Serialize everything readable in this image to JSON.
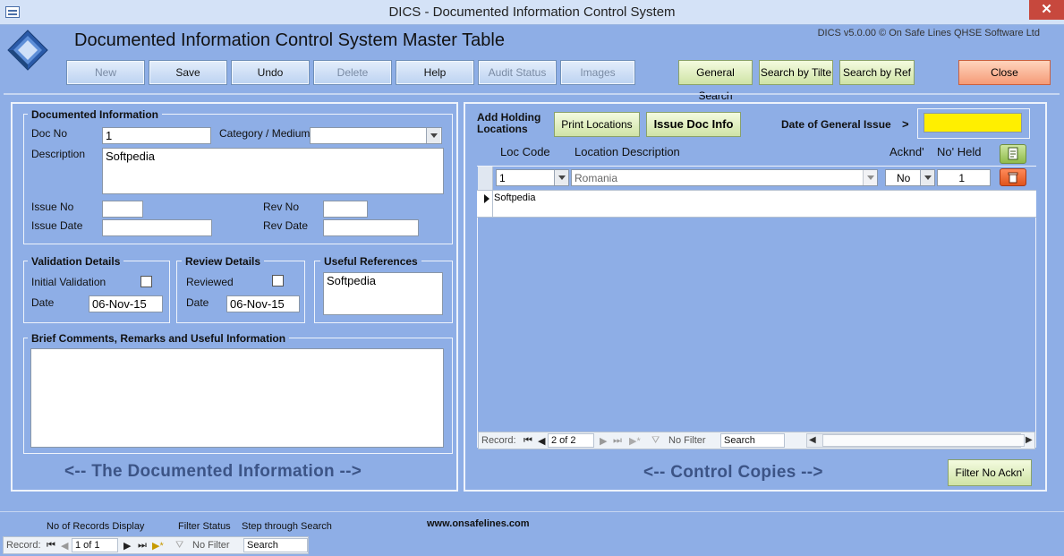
{
  "window": {
    "title": "DICS - Documented Information Control System",
    "close_glyph": "✕"
  },
  "header": {
    "title": "Documented Information Control System Master Table",
    "version": "DICS v5.0.00 © On Safe Lines QHSE Software Ltd"
  },
  "toolbar": {
    "new": "New",
    "save": "Save",
    "undo": "Undo",
    "delete": "Delete",
    "help": "Help",
    "audit": "Audit Status",
    "images": "Images",
    "general_search": "General Search",
    "search_title": "Search by Tilte",
    "search_ref": "Search by Ref",
    "close": "Close"
  },
  "doc_info": {
    "section_title": "Documented Information",
    "doc_no_label": "Doc No",
    "doc_no_value": "1",
    "category_label": "Category / Medium",
    "category_value": "",
    "description_label": "Description",
    "description_value": "Softpedia",
    "issue_no_label": "Issue No",
    "issue_no_value": "",
    "rev_no_label": "Rev No",
    "rev_no_value": "",
    "issue_date_label": "Issue Date",
    "issue_date_value": "",
    "rev_date_label": "Rev Date",
    "rev_date_value": ""
  },
  "validation": {
    "title": "Validation Details",
    "check_label": "Initial Validation",
    "date_label": "Date",
    "date_value": "06-Nov-15"
  },
  "review": {
    "title": "Review Details",
    "check_label": "Reviewed",
    "date_label": "Date",
    "date_value": "06-Nov-15"
  },
  "references": {
    "title": "Useful References",
    "value": "Softpedia"
  },
  "comments": {
    "title": "Brief Comments, Remarks and Useful Information",
    "value": ""
  },
  "left_caption": "<-- The Documented Information -->",
  "right_panel": {
    "add_holding": "Add Holding Locations",
    "print_locations": "Print Locations",
    "issue_doc_info": "Issue Doc Info",
    "general_issue_label": "Date of General Issue",
    "general_issue_arrow": ">",
    "general_issue_value": "",
    "columns": {
      "loc_code": "Loc Code",
      "loc_desc": "Location Description",
      "acknd": "Acknd'",
      "no_held": "No' Held"
    },
    "rows": [
      {
        "loc_code": "1",
        "loc_desc": "Romania",
        "acknd": "No",
        "no_held": "1"
      },
      {
        "loc_code": "Softpedia",
        "loc_desc": "",
        "acknd": "",
        "no_held": ""
      }
    ],
    "nav": {
      "record_label": "Record:",
      "position": "2 of 2",
      "filter": "No Filter",
      "search": "Search"
    },
    "caption": "<-- Control Copies -->",
    "filter_btn": "Filter No Ackn'"
  },
  "footer": {
    "records_display": "No of Records Display",
    "filter_status": "Filter Status",
    "step_search": "Step through Search",
    "website": "www.onsafelines.com",
    "nav": {
      "record_label": "Record:",
      "position": "1 of 1",
      "filter": "No Filter",
      "search": "Search"
    }
  },
  "colors": {
    "background": "#8eaee6",
    "highlight": "#ffef00",
    "close_button": "#f59b77",
    "search_button": "#cfe3a6"
  }
}
